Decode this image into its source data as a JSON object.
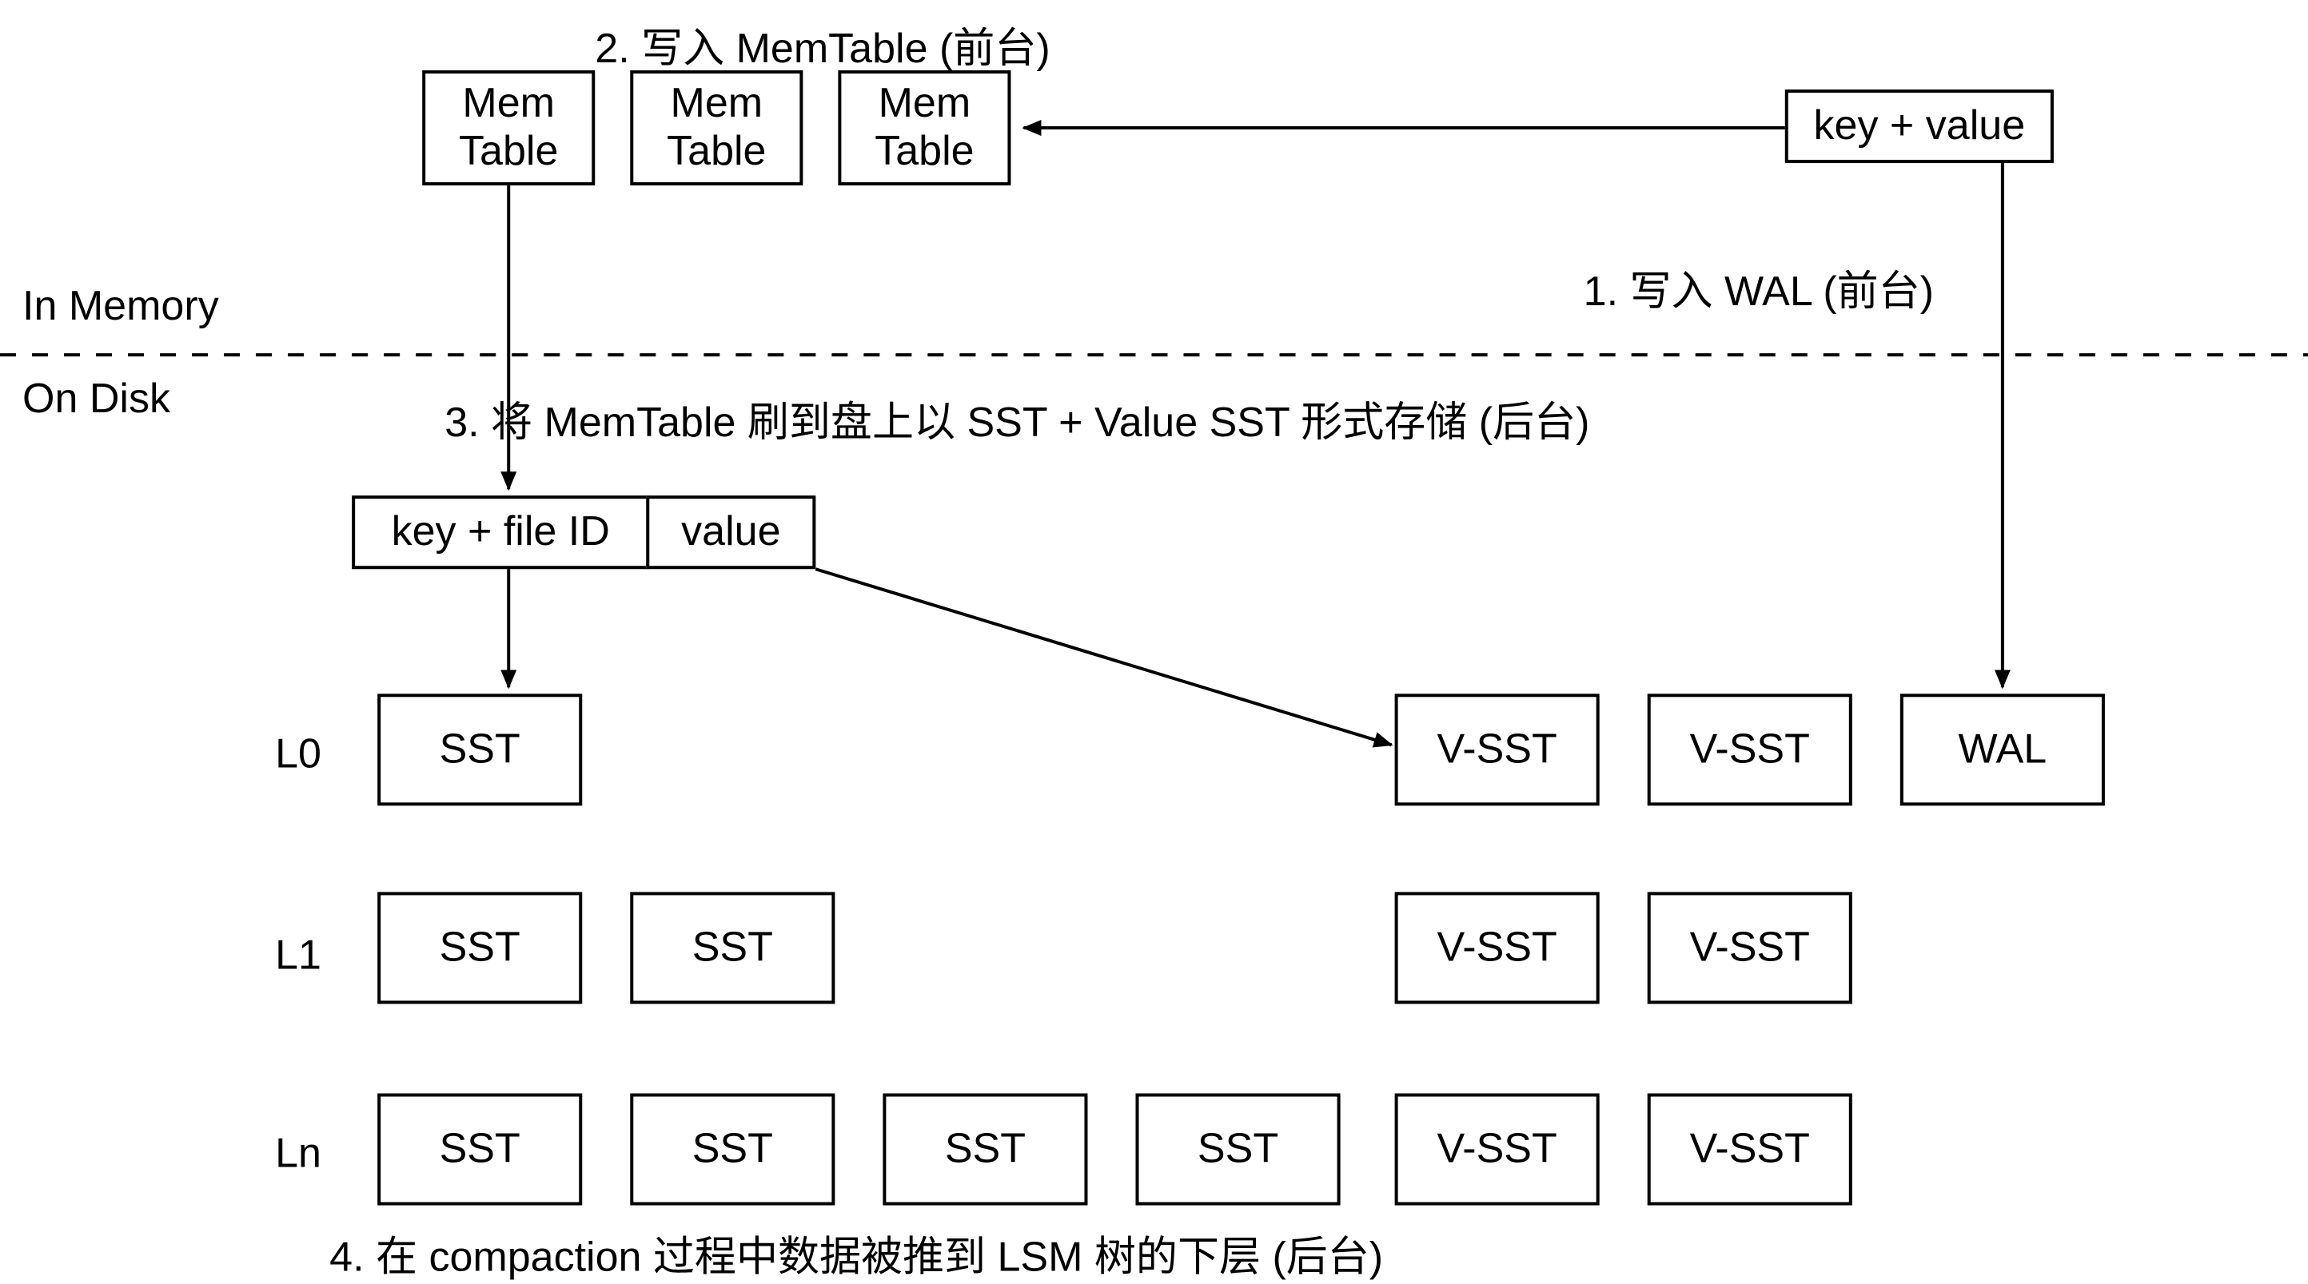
{
  "regions": {
    "in_memory": "In Memory",
    "on_disk": "On Disk"
  },
  "steps": {
    "s1": "1. 写入 WAL (前台)",
    "s2": "2. 写入 MemTable (前台)",
    "s3": "3. 将 MemTable 刷到盘上以 SST + Value SST 形式存储 (后台)",
    "s4": "4. 在 compaction 过程中数据被推到 LSM 树的下层 (后台)"
  },
  "nodes": {
    "memtable": "Mem\nTable",
    "key_value": "key + value",
    "key_file_id": "key + file ID",
    "value": "value",
    "sst": "SST",
    "vsst": "V-SST",
    "wal": "WAL"
  },
  "levels": {
    "l0": "L0",
    "l1": "L1",
    "ln": "Ln"
  }
}
